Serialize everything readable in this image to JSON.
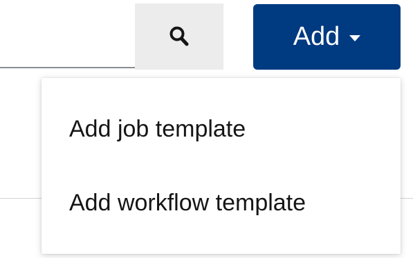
{
  "search": {
    "value": "",
    "placeholder": "",
    "button_icon": "search-icon"
  },
  "add_button": {
    "label": "Add",
    "icon": "caret-down-icon",
    "color": "#003a80"
  },
  "dropdown": {
    "items": [
      {
        "label": "Add job template"
      },
      {
        "label": "Add workflow template"
      }
    ]
  }
}
